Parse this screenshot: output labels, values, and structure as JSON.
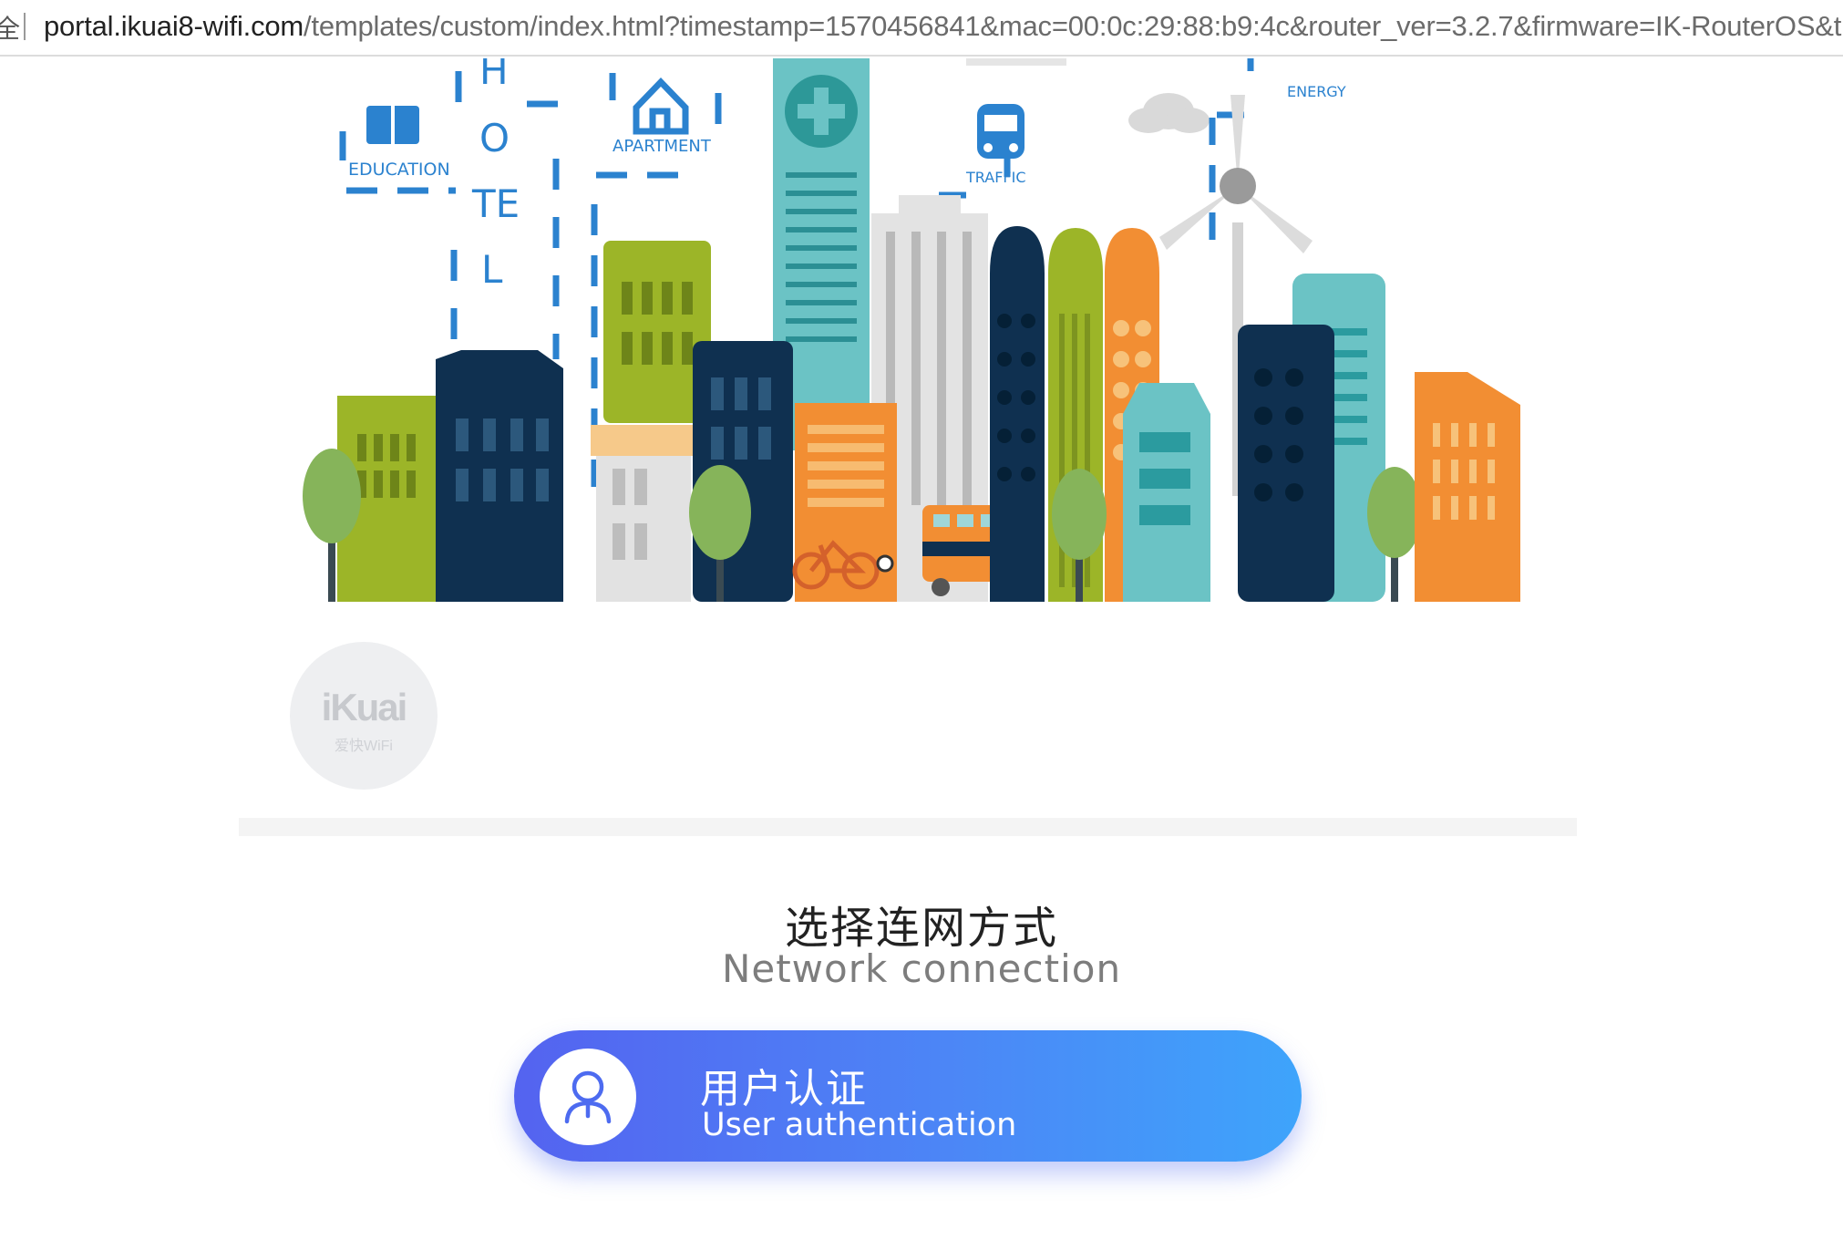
{
  "browser": {
    "security_glyph": "全",
    "url_host": "portal.ikuai8-wifi.com",
    "url_rest": "/templates/custom/index.html?timestamp=1570456841&mac=00:0c:29:88:b9:4c&router_ver=3.2.7&firmware=IK-RouterOS&t"
  },
  "banner": {
    "labels": {
      "education": "EDUCATION",
      "hotel_h": "H",
      "hotel_o": "O",
      "hotel_te": "TE",
      "hotel_l": "L",
      "apartment": "APARTMENT",
      "traffic": "TRAFFIC",
      "energy": "ENERGY"
    }
  },
  "logo": {
    "main": "iKuai",
    "sub": "爱快WiFi"
  },
  "connection": {
    "title_zh": "选择连网方式",
    "title_en": "Network connection",
    "options": [
      {
        "label_zh": "用户认证",
        "label_en": "User authentication",
        "icon": "user-icon"
      }
    ]
  },
  "colors": {
    "button_gradient_start": "#5463f0",
    "button_gradient_end": "#3ea4fb",
    "navy": "#0f3050",
    "lime": "#9cb528",
    "orange": "#f28e33",
    "teal": "#6bc3c5",
    "blue_dash": "#2b82cf"
  }
}
